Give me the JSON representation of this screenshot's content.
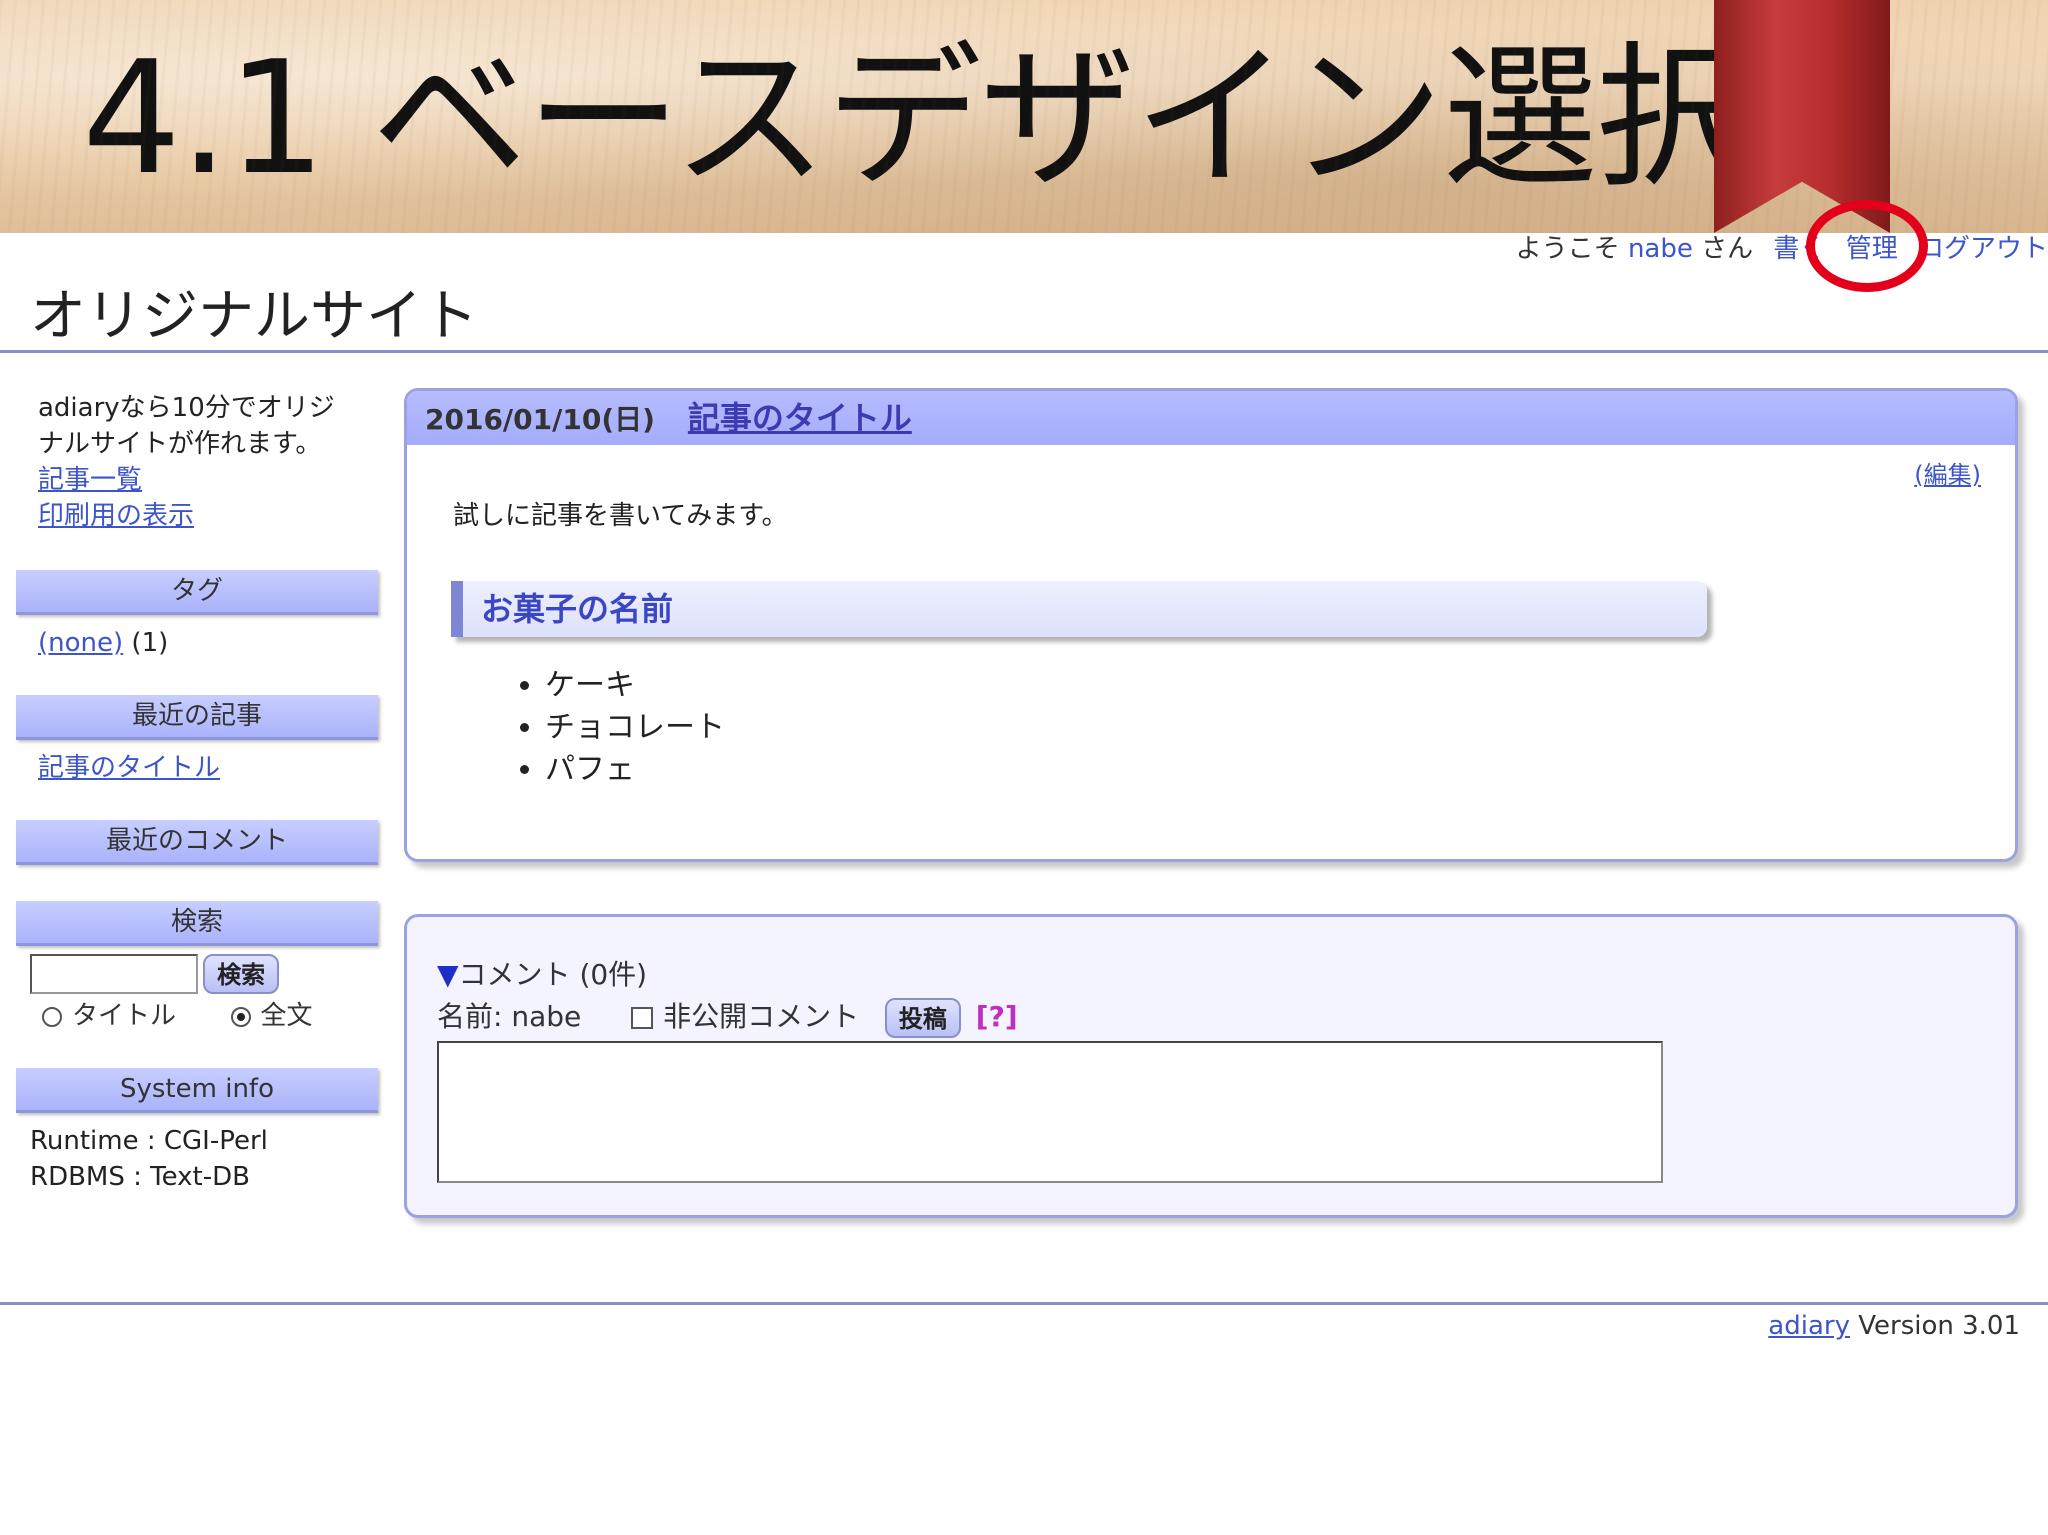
{
  "slide": {
    "title": "4.1 ベースデザイン選択"
  },
  "userbar": {
    "welcome": "ようこそ",
    "user": "nabe",
    "san": "さん",
    "write": "書く",
    "admin": "管理",
    "logout": "ログアウト"
  },
  "site": {
    "title": "オリジナルサイト"
  },
  "sidebar": {
    "intro": "adiaryなら10分でオリジナルサイトが作れます。",
    "links": [
      "記事一覧",
      "印刷用の表示"
    ],
    "tags": {
      "heading": "タグ",
      "item": "(none)",
      "count": "(1)"
    },
    "recent_articles": {
      "heading": "最近の記事",
      "item": "記事のタイトル"
    },
    "recent_comments": {
      "heading": "最近のコメント"
    },
    "search": {
      "heading": "検索",
      "button": "検索",
      "opt_title": "タイトル",
      "opt_full": "全文"
    },
    "sysinfo": {
      "heading": "System info",
      "runtime": "Runtime : CGI-Perl",
      "rdbms": "RDBMS : Text-DB"
    }
  },
  "article": {
    "date": "2016/01/10(日)",
    "title": "記事のタイトル",
    "edit": "(編集)",
    "body": "試しに記事を書いてみます。",
    "section": "お菓子の名前",
    "items": [
      "ケーキ",
      "チョコレート",
      "パフェ"
    ]
  },
  "comments": {
    "title": "コメント (0件)",
    "name_label": "名前: nabe",
    "private_label": "非公開コメント",
    "post_button": "投稿",
    "help": "[?]"
  },
  "footer": {
    "link": "adiary",
    "version": "Version 3.01"
  }
}
